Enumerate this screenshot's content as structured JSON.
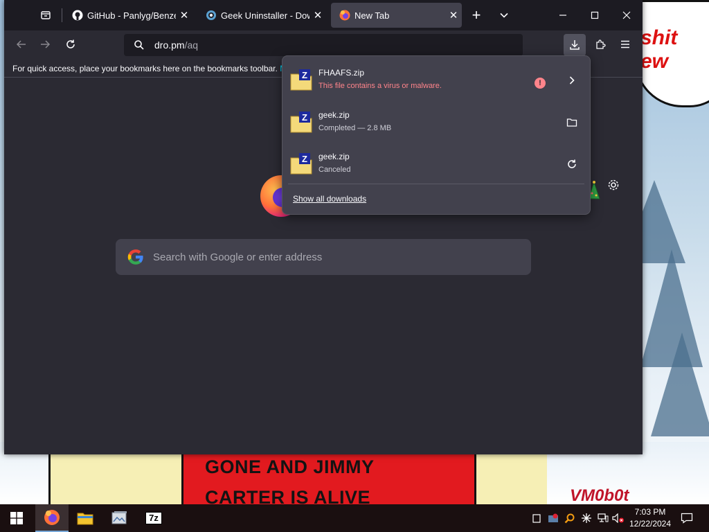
{
  "browser": {
    "tabs": [
      {
        "label": "GitHub - Panlyg/Benzene",
        "icon": "github-icon"
      },
      {
        "label": "Geek Uninstaller - Downloads",
        "icon": "geek-icon"
      },
      {
        "label": "New Tab",
        "icon": "firefox-icon",
        "active": true
      }
    ],
    "url": {
      "host": "dro.pm",
      "path": "/aq"
    },
    "bookmarks_message": "For quick access, place your bookmarks here on the bookmarks toolbar.",
    "bookmarks_link": "M",
    "search_placeholder": "Search with Google or enter address"
  },
  "downloads": {
    "items": [
      {
        "name": "FHAAFS.zip",
        "status": "This file contains a virus or malware.",
        "state": "blocked",
        "action": "chevron-right-icon"
      },
      {
        "name": "geek.zip",
        "status": "Completed — 2.8 MB",
        "state": "completed",
        "action": "folder-icon"
      },
      {
        "name": "geek.zip",
        "status": "Canceled",
        "state": "canceled",
        "action": "retry-icon"
      }
    ],
    "show_all": "Show all downloads",
    "warn_glyph": "!"
  },
  "wallpaper": {
    "bubble_text": "shit\new",
    "comic_text_1": "GONE AND JIMMY",
    "comic_text_2": "CARTER IS ALIVE",
    "signature": "VM0b0t"
  },
  "taskbar": {
    "apps": [
      "start-icon",
      "firefox-icon",
      "file-explorer-icon",
      "image-viewer-icon",
      "7zip-icon"
    ],
    "seven_zip_label": "7z",
    "time": "7:03 PM",
    "date": "12/22/2024"
  },
  "colors": {
    "accent": "#00ddff",
    "error": "#ff848b",
    "toolbar": "#2b2a33",
    "tabbar": "#1c1b22"
  }
}
